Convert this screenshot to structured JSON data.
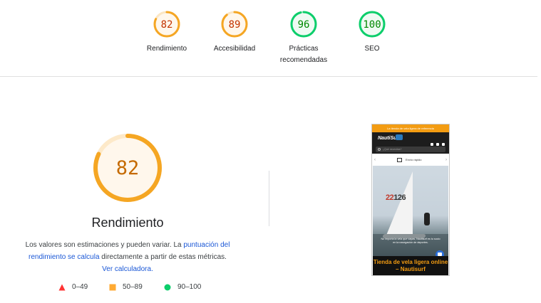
{
  "summary": [
    {
      "score": "82",
      "label": "Rendimiento",
      "value": 82,
      "color": "#f5a623",
      "text_color": "#c33300",
      "bg": "#fff7ec"
    },
    {
      "score": "89",
      "label": "Accesibilidad",
      "value": 89,
      "color": "#f5a623",
      "text_color": "#c33300",
      "bg": "#fff7ec"
    },
    {
      "score": "96",
      "label_line1": "Prácticas",
      "label_line2": "recomendadas",
      "value": 96,
      "color": "#0cce6b",
      "text_color": "#008800",
      "bg": "#effaf3"
    },
    {
      "score": "100",
      "label": "SEO",
      "value": 100,
      "color": "#0cce6b",
      "text_color": "#008800",
      "bg": "#effaf3"
    }
  ],
  "main": {
    "score": "82",
    "value": 82,
    "color": "#f5a623",
    "title": "Rendimiento",
    "desc_text1": "Los valores son estimaciones y pueden variar. La ",
    "desc_link1": "puntuación del rendimiento se calcula",
    "desc_text2": " directamente a partir de estas métricas. ",
    "desc_link2": "Ver calculadora."
  },
  "legend": [
    {
      "range": "0–49",
      "shape": "triangle",
      "color": "#ff3333"
    },
    {
      "range": "50–89",
      "shape": "square",
      "color": "#ffaa33"
    },
    {
      "range": "90–100",
      "shape": "circle",
      "color": "#0cce6b"
    }
  ],
  "screenshot": {
    "promo_text": "La tienda de vela ligera de referencia",
    "logo_text": "NautiSurf",
    "search_placeholder": "¿Qué necesitas?",
    "shipping_text": "Envío rápido",
    "sail_number": "22",
    "sail_number_rest": "126",
    "hero_text": "No importa la vela que vayas, Nautisurf es tu socio en la navegación de deportes.",
    "banner_text": "Tienda de vela ligera online – Nautisurf",
    "accent_color": "#f39c12"
  }
}
